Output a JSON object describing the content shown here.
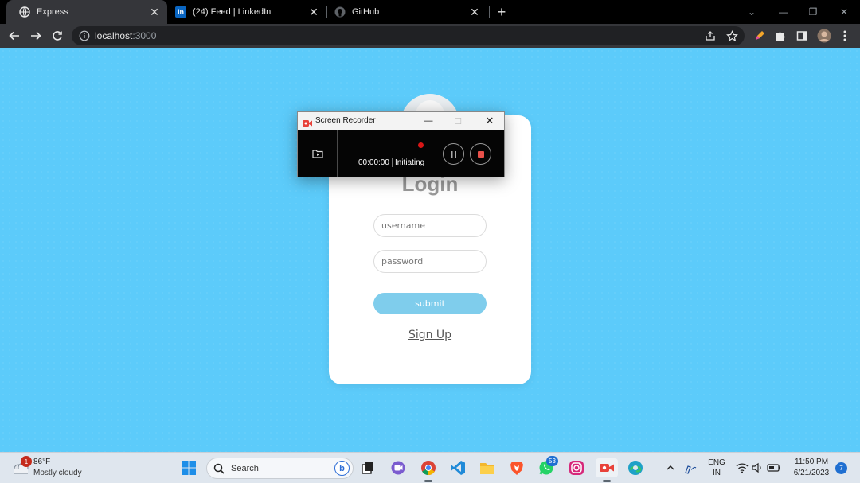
{
  "browser": {
    "tabs": [
      {
        "title": "Express",
        "active": true
      },
      {
        "title": "(24) Feed | LinkedIn",
        "active": false
      },
      {
        "title": "GitHub",
        "active": false
      }
    ],
    "new_tab_label": "+",
    "url_host": "localhost",
    "url_port": ":3000"
  },
  "login": {
    "title": "Login",
    "username_placeholder": "username",
    "password_placeholder": "password",
    "submit_label": "submit",
    "signup_label": "Sign Up"
  },
  "recorder": {
    "title": "Screen Recorder",
    "elapsed": "00:00:00",
    "status": "Initiating"
  },
  "taskbar": {
    "weather_badge": "1",
    "temperature": "86°F",
    "condition": "Mostly cloudy",
    "search_label": "Search",
    "whatsapp_badge": "53",
    "language_line1": "ENG",
    "language_line2": "IN",
    "time": "11:50 PM",
    "date": "6/21/2023",
    "notification_count": "7"
  },
  "colors": {
    "page_background": "#5ccbfa",
    "submit_button": "#7fcdec",
    "record_dot": "#d91616"
  }
}
